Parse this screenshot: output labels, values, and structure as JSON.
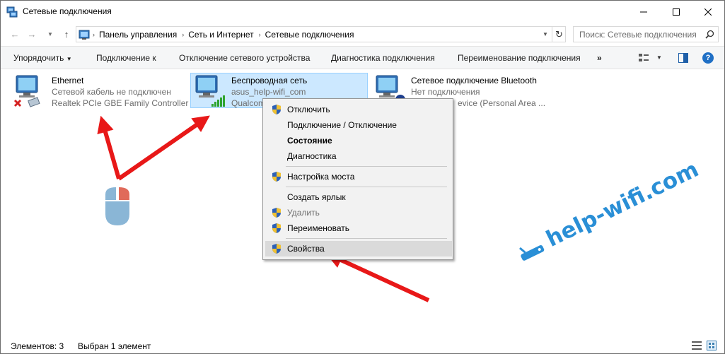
{
  "window": {
    "title": "Сетевые подключения"
  },
  "address": {
    "path": [
      "Панель управления",
      "Сеть и Интернет",
      "Сетевые подключения"
    ],
    "search_placeholder": "Поиск: Сетевые подключения"
  },
  "commands": {
    "organize": "Упорядочить",
    "connect": "Подключение к",
    "disable": "Отключение сетевого устройства",
    "diagnose": "Диагностика подключения",
    "rename": "Переименование подключения",
    "more": "»"
  },
  "connections": [
    {
      "name": "Ethernet",
      "status": "Сетевой кабель не подключен",
      "device": "Realtek PCIe GBE Family Controller"
    },
    {
      "name": "Беспроводная сеть",
      "status": "asus_help-wifi_com",
      "device": "Qualcomm"
    },
    {
      "name": "Сетевое подключение Bluetooth",
      "status": "Нет подключения",
      "device": "evice (Personal Area ..."
    }
  ],
  "context_menu": {
    "items": [
      {
        "label": "Отключить",
        "shield": true
      },
      {
        "label": "Подключение / Отключение",
        "bold": false
      },
      {
        "label": "Состояние",
        "bold": true
      },
      {
        "label": "Диагностика"
      },
      {
        "label": "Настройка моста",
        "shield": true
      },
      {
        "label": "Создать ярлык"
      },
      {
        "label": "Удалить",
        "shield": true,
        "disabled": true
      },
      {
        "label": "Переименовать",
        "shield": true
      },
      {
        "label": "Свойства",
        "shield": true,
        "highlighted": true
      }
    ]
  },
  "status_bar": {
    "count": "Элементов: 3",
    "selected": "Выбран 1 элемент"
  },
  "watermark": "help-wifi.com",
  "colors": {
    "selection_bg": "#cce8ff",
    "arrow": "#e81818",
    "watermark": "#2a8fd6"
  }
}
